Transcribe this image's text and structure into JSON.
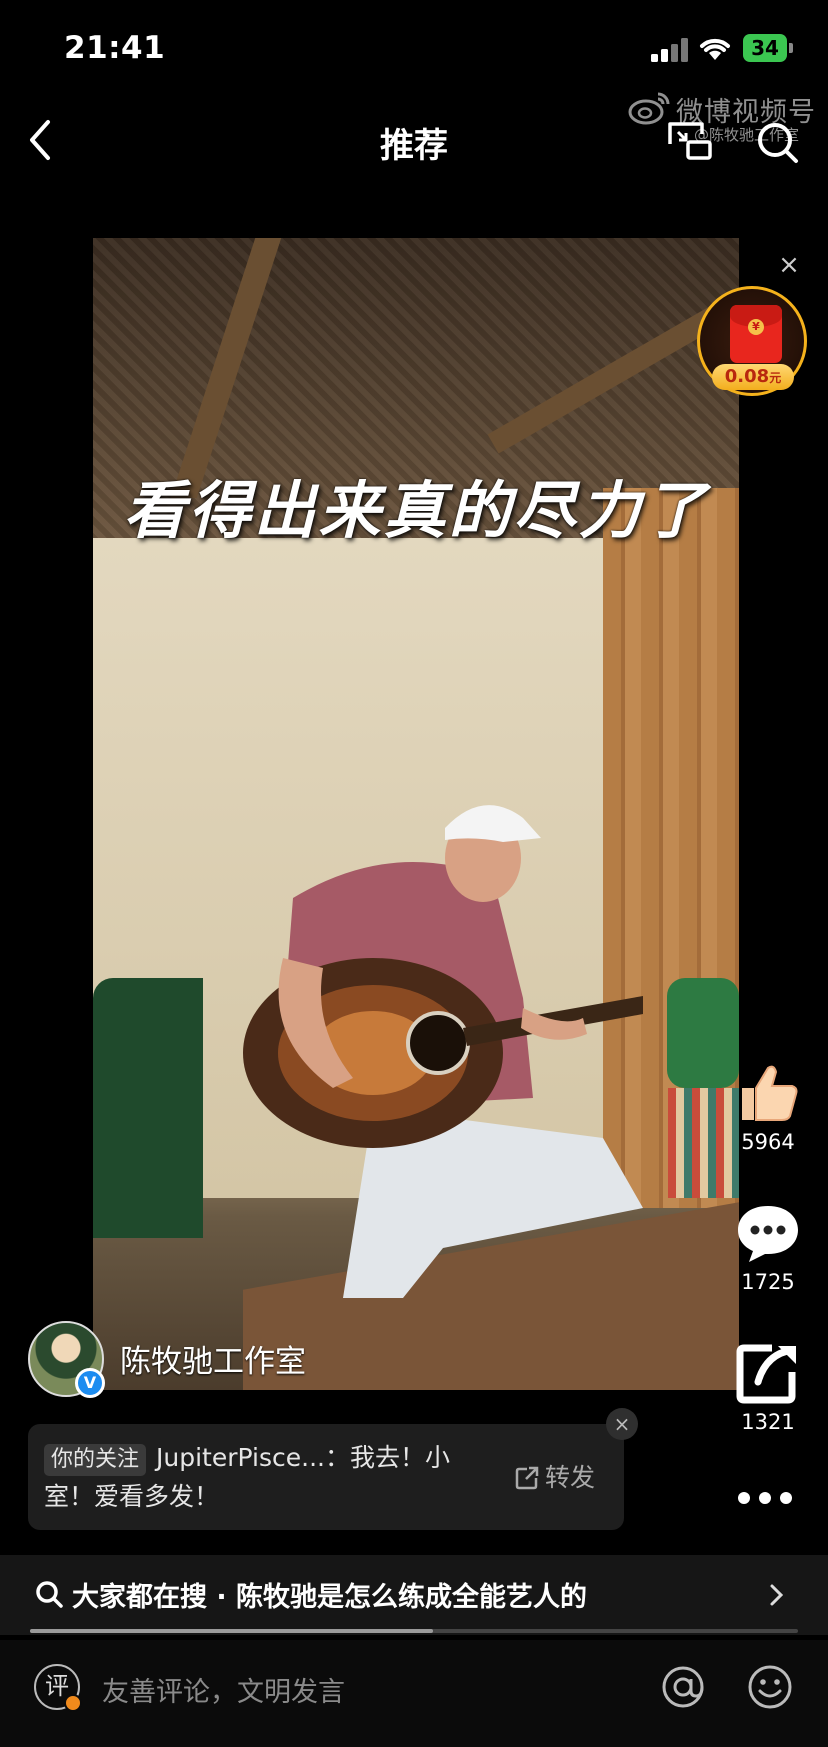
{
  "status_bar": {
    "time": "21:41",
    "battery": "34"
  },
  "header": {
    "title": "推荐",
    "back_icon": "chevron-left-icon",
    "pip_icon": "picture-in-picture-icon",
    "search_icon": "search-icon"
  },
  "watermark": {
    "brand": "微博视频号",
    "sub": "@陈牧驰工作室"
  },
  "video": {
    "caption": "看得出来真的尽力了"
  },
  "red_packet": {
    "amount": "0.08",
    "unit": "元",
    "close": "×"
  },
  "actions": {
    "like_count": "5964",
    "comment_count": "1725",
    "share_count": "1321"
  },
  "author": {
    "name": "陈牧驰工作室",
    "verified": "V"
  },
  "comment_card": {
    "tag": "你的关注",
    "text": "JupiterPisce...：我去！小室！爱看多发！",
    "forward_label": "转发",
    "close": "×"
  },
  "search_suggestion": {
    "text": "大家都在搜 · 陈牧驰是怎么练成全能艺人的"
  },
  "progress": {
    "fraction": 0.525
  },
  "bottom_bar": {
    "comment_icon_label": "评",
    "placeholder": "友善评论，文明发言"
  },
  "colors": {
    "accent_gold": "#f5b21c",
    "verified_blue": "#1c8cf0",
    "red_packet": "#e8261e"
  }
}
